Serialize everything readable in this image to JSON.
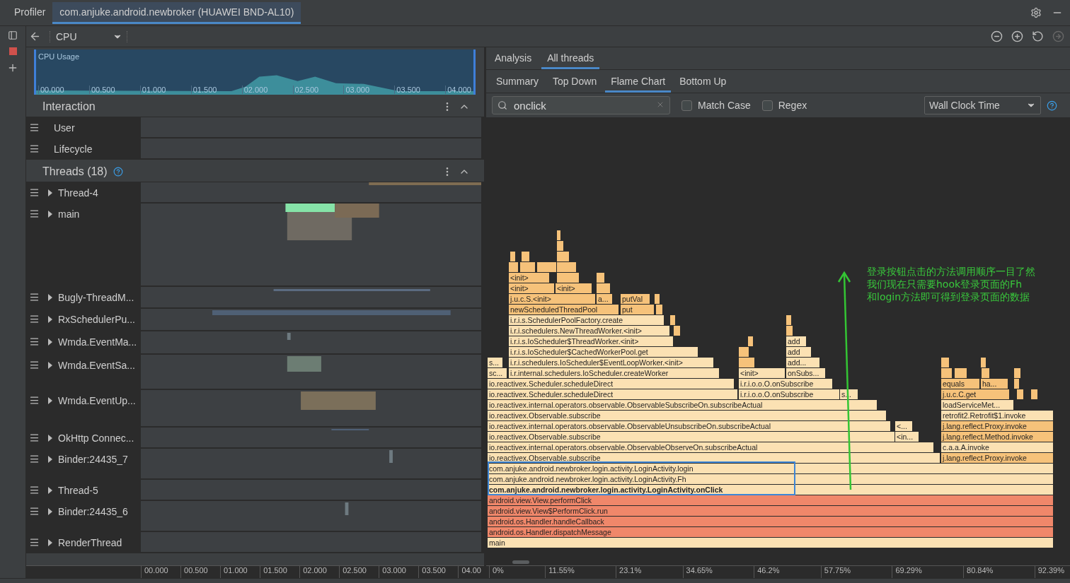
{
  "title_bar": {
    "tabs": [
      {
        "label": "Profiler",
        "selected": false
      },
      {
        "label": "com.anjuke.android.newbroker (HUAWEI BND-AL10)",
        "selected": true
      }
    ]
  },
  "toolbar": {
    "profiler": "CPU"
  },
  "cpu_usage": {
    "title": "CPU Usage",
    "ticks": [
      "00.000",
      "00.500",
      "01.000",
      "01.500",
      "02.000",
      "02.500",
      "03.000",
      "03.500",
      "04.000"
    ]
  },
  "interaction": {
    "title": "Interaction",
    "rows": [
      "User",
      "Lifecycle"
    ]
  },
  "threads": {
    "title": "Threads (18)",
    "rows": [
      "Thread-4",
      "main",
      "Bugly-ThreadM...",
      "RxSchedulerPu...",
      "Wmda.EventMa...",
      "Wmda.EventSa...",
      "Wmda.EventUp...",
      "OkHttp Connec...",
      "Binder:24435_7",
      "Thread-5",
      "Binder:24435_6",
      "RenderThread"
    ]
  },
  "timeline_axis": [
    "00.000",
    "00.500",
    "01.000",
    "01.500",
    "02.000",
    "02.500",
    "03.000",
    "03.500",
    "04.00"
  ],
  "analysis": {
    "tabs": [
      {
        "label": "Analysis",
        "selected": false
      },
      {
        "label": "All threads",
        "selected": true
      }
    ],
    "subtabs": [
      {
        "label": "Summary",
        "selected": false
      },
      {
        "label": "Top Down",
        "selected": false
      },
      {
        "label": "Flame Chart",
        "selected": true
      },
      {
        "label": "Bottom Up",
        "selected": false
      }
    ],
    "search": {
      "value": "onclick"
    },
    "options": [
      {
        "label": "Match Case",
        "checked": false
      },
      {
        "label": "Regex",
        "checked": false
      }
    ],
    "clock": "Wall Clock Time",
    "flame_chart": {
      "frames": [
        {
          "label": "<init>",
          "color": "#f6c27a",
          "bold": false
        },
        {
          "label": "<init>",
          "color": "#f6c27a",
          "bold": false
        },
        {
          "label": "<init>",
          "color": "#f6c27a",
          "bold": false
        },
        {
          "label": "j.u.c.S.<init>",
          "color": "#f6c27a",
          "bold": false
        },
        {
          "label": "a...",
          "color": "#f6c27a",
          "bold": false
        },
        {
          "label": "putVal",
          "color": "#f6c27a",
          "bold": false
        },
        {
          "label": "newScheduledThreadPool",
          "color": "#f6c27a",
          "bold": false
        },
        {
          "label": "put",
          "color": "#f6c27a",
          "bold": false
        },
        {
          "label": "i.r.i.s.SchedulerPoolFactory.create",
          "color": "#fbe1b3",
          "bold": false
        },
        {
          "label": "i.r.i.schedulers.NewThreadWorker.<init>",
          "color": "#fbe1b3",
          "bold": false
        },
        {
          "label": "i.r.i.s.IoScheduler$ThreadWorker.<init>",
          "color": "#fbe1b3",
          "bold": false
        },
        {
          "label": "add",
          "color": "#fbe1b3",
          "bold": false
        },
        {
          "label": "i.r.i.s.IoScheduler$CachedWorkerPool.get",
          "color": "#fbe1b3",
          "bold": false
        },
        {
          "label": "add",
          "color": "#fbe1b3",
          "bold": false
        },
        {
          "label": "s...",
          "color": "#fbe1b3",
          "bold": false
        },
        {
          "label": "i.r.i.schedulers.IoScheduler$EventLoopWorker.<init>",
          "color": "#fbe1b3",
          "bold": false
        },
        {
          "label": "add...",
          "color": "#fbe1b3",
          "bold": false
        },
        {
          "label": "sc...",
          "color": "#fbe1b3",
          "bold": false
        },
        {
          "label": "i.r.internal.schedulers.IoScheduler.createWorker",
          "color": "#fbe1b3",
          "bold": false
        },
        {
          "label": "<init>",
          "color": "#fbe1b3",
          "bold": false
        },
        {
          "label": "onSubs...",
          "color": "#fbe1b3",
          "bold": false
        },
        {
          "label": "io.reactivex.Scheduler.scheduleDirect",
          "color": "#fbe1b3",
          "bold": false
        },
        {
          "label": "i.r.i.o.o.O.onSubscribe",
          "color": "#fbe1b3",
          "bold": false
        },
        {
          "label": "equals",
          "color": "#f6c27a",
          "bold": false
        },
        {
          "label": "ha...",
          "color": "#f6c27a",
          "bold": false
        },
        {
          "label": "io.reactivex.Scheduler.scheduleDirect",
          "color": "#fbe1b3",
          "bold": false
        },
        {
          "label": "i.r.i.o.o.O.onSubscribe",
          "color": "#fbe1b3",
          "bold": false
        },
        {
          "label": "s...",
          "color": "#fbe1b3",
          "bold": false
        },
        {
          "label": "j.u.c.C.get",
          "color": "#f6c27a",
          "bold": false
        },
        {
          "label": "io.reactivex.internal.operators.observable.ObservableSubscribeOn.subscribeActual",
          "color": "#fbe1b3",
          "bold": false
        },
        {
          "label": "loadServiceMet...",
          "color": "#fbe1b3",
          "bold": false
        },
        {
          "label": "io.reactivex.Observable.subscribe",
          "color": "#fbe1b3",
          "bold": false
        },
        {
          "label": "retrofit2.Retrofit$1.invoke",
          "color": "#fbe1b3",
          "bold": false
        },
        {
          "label": "io.reactivex.internal.operators.observable.ObservableUnsubscribeOn.subscribeActual",
          "color": "#fbe1b3",
          "bold": false
        },
        {
          "label": "<...",
          "color": "#fbe1b3",
          "bold": false
        },
        {
          "label": "j.lang.reflect.Proxy.invoke",
          "color": "#f6c27a",
          "bold": false
        },
        {
          "label": "io.reactivex.Observable.subscribe",
          "color": "#fbe1b3",
          "bold": false
        },
        {
          "label": "<in...",
          "color": "#fbe1b3",
          "bold": false
        },
        {
          "label": "j.lang.reflect.Method.invoke",
          "color": "#f6c27a",
          "bold": false
        },
        {
          "label": "io.reactivex.internal.operators.observable.ObservableObserveOn.subscribeActual",
          "color": "#fbe1b3",
          "bold": false
        },
        {
          "label": "c.a.a.A.invoke",
          "color": "#fbe1b3",
          "bold": false
        },
        {
          "label": "io.reactivex.Observable.subscribe",
          "color": "#fbe1b3",
          "bold": false
        },
        {
          "label": "j.lang.reflect.Proxy.invoke",
          "color": "#f6c27a",
          "bold": false
        },
        {
          "label": "com.anjuke.android.newbroker.login.activity.LoginActivity.login",
          "color": "#fbe1b3",
          "bold": false
        },
        {
          "label": "com.anjuke.android.newbroker.login.activity.LoginActivity.Fh",
          "color": "#fbe1b3",
          "bold": false
        },
        {
          "label": "com.anjuke.android.newbroker.login.activity.LoginActivity.onClick",
          "color": "#fbe1b3",
          "bold": true
        },
        {
          "label": "android.view.View.performClick",
          "color": "#f0876a",
          "bold": false
        },
        {
          "label": "android.view.View$PerformClick.run",
          "color": "#f0876a",
          "bold": false
        },
        {
          "label": "android.os.Handler.handleCallback",
          "color": "#f0876a",
          "bold": false
        },
        {
          "label": "android.os.Handler.dispatchMessage",
          "color": "#f0876a",
          "bold": false
        },
        {
          "label": "main",
          "color": "#fbe1b3",
          "bold": false
        }
      ]
    },
    "axis": [
      "0%",
      "11.55%",
      "23.1%",
      "34.65%",
      "46.2%",
      "57.75%",
      "69.29%",
      "80.84%",
      "92.39%"
    ]
  },
  "annotation": {
    "lines": [
      "登录按钮点击的方法调用顺序一目了然",
      "我们现在只需要hook登录页面的Fh",
      "和login方法即可得到登录页面的数据"
    ]
  }
}
